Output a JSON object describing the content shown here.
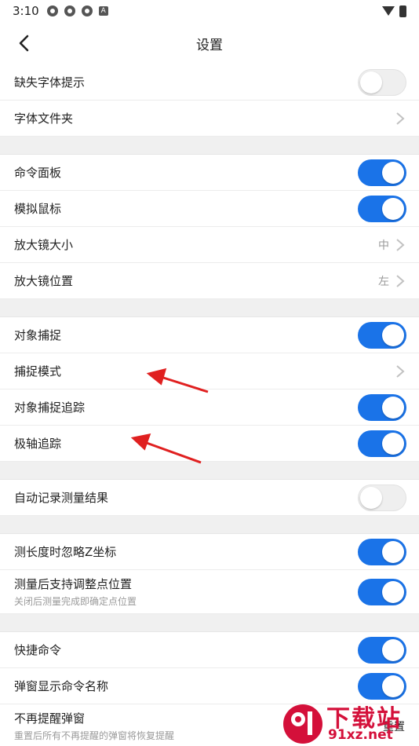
{
  "status_bar": {
    "time": "3:10",
    "notification_icons": [
      "app-icon",
      "app-icon",
      "app-icon",
      "a-icon"
    ],
    "a_icon_text": "A"
  },
  "header": {
    "title": "设置"
  },
  "groups": [
    {
      "rows": [
        {
          "label": "缺失字体提示",
          "control": "toggle",
          "on": false
        },
        {
          "label": "字体文件夹",
          "control": "chevron"
        }
      ]
    },
    {
      "rows": [
        {
          "label": "命令面板",
          "control": "toggle",
          "on": true
        },
        {
          "label": "模拟鼠标",
          "control": "toggle",
          "on": true
        },
        {
          "label": "放大镜大小",
          "control": "chevron",
          "value": "中"
        },
        {
          "label": "放大镜位置",
          "control": "chevron",
          "value": "左"
        }
      ]
    },
    {
      "rows": [
        {
          "label": "对象捕捉",
          "control": "toggle",
          "on": true
        },
        {
          "label": "捕捉模式",
          "control": "chevron"
        },
        {
          "label": "对象捕捉追踪",
          "control": "toggle",
          "on": true
        },
        {
          "label": "极轴追踪",
          "control": "toggle",
          "on": true
        }
      ]
    },
    {
      "rows": [
        {
          "label": "自动记录测量结果",
          "control": "toggle",
          "on": false
        }
      ]
    },
    {
      "rows": [
        {
          "label": "测长度时忽略Z坐标",
          "control": "toggle",
          "on": true
        },
        {
          "label": "测量后支持调整点位置",
          "sub": "关闭后测量完成即确定点位置",
          "control": "toggle",
          "on": true
        }
      ]
    },
    {
      "rows": [
        {
          "label": "快捷命令",
          "control": "toggle",
          "on": true
        },
        {
          "label": "弹窗显示命令名称",
          "control": "toggle",
          "on": true
        },
        {
          "label": "不再提醒弹窗",
          "sub": "重置后所有不再提醒的弹窗将恢复提醒",
          "control": "reset",
          "button": "重置"
        }
      ]
    }
  ],
  "watermark": {
    "title": "下载站",
    "url": "91xz.net"
  },
  "colors": {
    "accent": "#1a73e8",
    "annotation_arrow": "#e02020",
    "watermark": "#d4103a"
  }
}
